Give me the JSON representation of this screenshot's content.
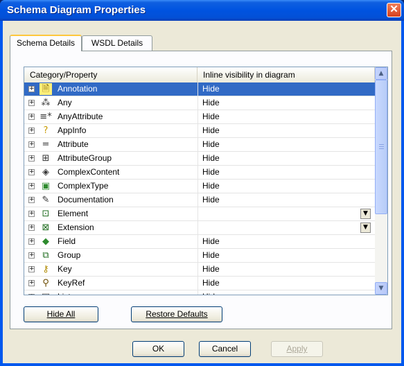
{
  "window": {
    "title": "Schema Diagram Properties",
    "close_glyph": "✕"
  },
  "tabs": [
    {
      "label": "Schema Details",
      "active": true
    },
    {
      "label": "WSDL Details",
      "active": false
    }
  ],
  "grid": {
    "columns": [
      "Category/Property",
      "Inline visibility in diagram"
    ],
    "rows": [
      {
        "icon": "annotation-icon",
        "label": "Annotation",
        "value": "Hide",
        "selected": true
      },
      {
        "icon": "any-icon",
        "label": "Any",
        "value": "Hide"
      },
      {
        "icon": "any-attribute-icon",
        "label": "AnyAttribute",
        "value": "Hide"
      },
      {
        "icon": "appinfo-icon",
        "label": "AppInfo",
        "value": "Hide"
      },
      {
        "icon": "attribute-icon",
        "label": "Attribute",
        "value": "Hide"
      },
      {
        "icon": "attribute-group-icon",
        "label": "AttributeGroup",
        "value": "Hide"
      },
      {
        "icon": "complex-content-icon",
        "label": "ComplexContent",
        "value": "Hide"
      },
      {
        "icon": "complex-type-icon",
        "label": "ComplexType",
        "value": "Hide"
      },
      {
        "icon": "documentation-icon",
        "label": "Documentation",
        "value": "Hide"
      },
      {
        "icon": "element-icon",
        "label": "Element",
        "value": "",
        "dropdown": true
      },
      {
        "icon": "extension-icon",
        "label": "Extension",
        "value": "",
        "dropdown": true
      },
      {
        "icon": "field-icon",
        "label": "Field",
        "value": "Hide"
      },
      {
        "icon": "group-icon",
        "label": "Group",
        "value": "Hide"
      },
      {
        "icon": "key-icon",
        "label": "Key",
        "value": "Hide"
      },
      {
        "icon": "keyref-icon",
        "label": "KeyRef",
        "value": "Hide"
      },
      {
        "icon": "list-icon",
        "label": "List",
        "value": "Hide"
      }
    ]
  },
  "buttons": {
    "hide_all": "Hide All",
    "restore_defaults": "Restore Defaults",
    "ok": "OK",
    "cancel": "Cancel",
    "apply": "Apply"
  },
  "colors": {
    "selection": "#316ac5",
    "titlebar": "#0053e0",
    "dialog_bg": "#ece9d8"
  }
}
